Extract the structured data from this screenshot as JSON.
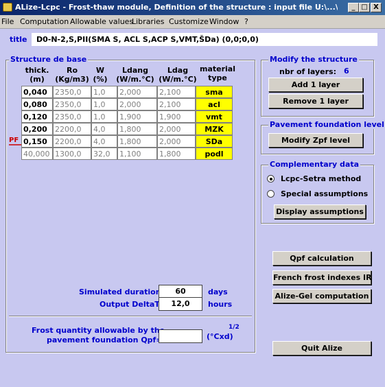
{
  "window": {
    "title": "ALize-Lcpc - Frost-thaw module, Definition of the structure : input file U:\\...\\...\\na ko...",
    "controls": {
      "minimize": "_",
      "maximize": "□",
      "close": "X"
    }
  },
  "menu": [
    "File",
    "Computation",
    "Allowable values",
    "Libraries",
    "Customize",
    "Window",
    "?"
  ],
  "title_field": {
    "label": "title",
    "value": "D0-N-2,S,PII(SMA S, ACL S,ACP S,VMT,ŠDa) (0,0;0,0)"
  },
  "structure": {
    "group_title": "Structure de base",
    "headers": {
      "thick": [
        "thick.",
        "(m)"
      ],
      "ro": [
        "Ro",
        "(Kg/m3)"
      ],
      "w": [
        "W",
        "(%)"
      ],
      "ldang": [
        "Ldang",
        "(W/m.°C)"
      ],
      "ldag": [
        "Ldag",
        "(W/m.°C)"
      ],
      "material": [
        "material",
        "type"
      ]
    },
    "pf_label": "PF",
    "rows": [
      {
        "thick": "0,040",
        "ro": "2350,0",
        "w": "1,0",
        "ldang": "2,000",
        "ldag": "2,100",
        "material": "sma"
      },
      {
        "thick": "0,080",
        "ro": "2350,0",
        "w": "1,0",
        "ldang": "2,000",
        "ldag": "2,100",
        "material": "acl"
      },
      {
        "thick": "0,120",
        "ro": "2350,0",
        "w": "1,0",
        "ldang": "1,900",
        "ldag": "1,900",
        "material": "vmt"
      },
      {
        "thick": "0,200",
        "ro": "2200,0",
        "w": "4,0",
        "ldang": "1,800",
        "ldag": "2,000",
        "material": "MZK"
      },
      {
        "thick": "0,150",
        "ro": "2200,0",
        "w": "4,0",
        "ldang": "1,800",
        "ldag": "2,000",
        "material": "SDa"
      },
      {
        "thick": "40,000",
        "ro": "1300,0",
        "w": "32,0",
        "ldang": "1,100",
        "ldag": "1,800",
        "material": "podl"
      }
    ],
    "simulated_duration": {
      "label": "Simulated duration=",
      "value": "60",
      "unit": "days"
    },
    "output_deltat": {
      "label": "Output DeltaT=",
      "value": "12,0",
      "unit": "hours"
    },
    "frost_quantity": {
      "label_line1": "Frost quantity allowable by the",
      "label_line2": "pavement foundation Qpf=",
      "value": "",
      "unit": "(°Cxd)",
      "exponent": "1/2"
    }
  },
  "modify": {
    "group_title": "Modify the structure",
    "layers_label": "nbr of layers:",
    "layers_value": "6",
    "add_button": "Add 1 layer",
    "remove_button": "Remove 1 layer"
  },
  "foundation": {
    "group_title": "Pavement foundation level",
    "modify_button": "Modify Zpf level"
  },
  "complementary": {
    "group_title": "Complementary data",
    "options": [
      {
        "label": "Lcpc-Setra method",
        "selected": true
      },
      {
        "label": "Special assumptions",
        "selected": false
      }
    ],
    "display_button": "Display assumptions"
  },
  "actions": {
    "qpf": "Qpf calculation",
    "french": "French frost indexes IR",
    "alize_gel": "Alize-Gel computation",
    "quit": "Quit Alize"
  },
  "colors": {
    "label_blue": "#0000cc",
    "material_yellow": "#ffff00",
    "background": "#c8c8f0",
    "pf_red": "#cc0000"
  }
}
